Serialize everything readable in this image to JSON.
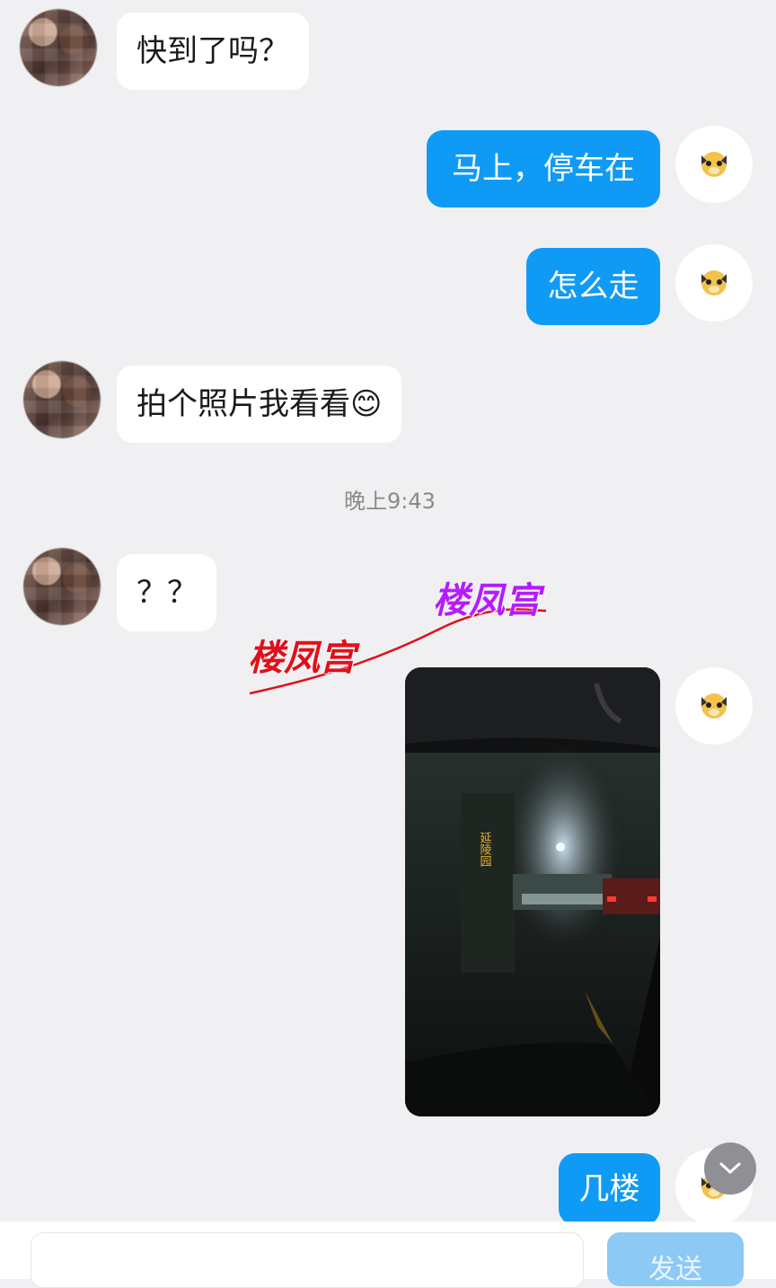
{
  "messages": {
    "m1": "快到了吗？",
    "m2": "马上，停车在",
    "m3": "怎么走",
    "m4_text": "拍个照片我看看",
    "m4_emoji": "😊",
    "time_divider": "晚上9:43",
    "m5": "？？",
    "m6": "几楼"
  },
  "photo": {
    "sign_text": "延陵园"
  },
  "watermarks": {
    "left": "楼凤宫",
    "right": "楼凤宫",
    "left_color": "#e0101a",
    "right_color": "#b41cff"
  },
  "composer": {
    "send_label": "发送"
  },
  "colors": {
    "outgoing_bubble": "#0f9bf5",
    "incoming_bubble": "#ffffff",
    "background": "#f0f0f3"
  },
  "icons": {
    "scroll_down": "chevron-down-icon",
    "outgoing_avatar": "dog-avatar-icon"
  }
}
